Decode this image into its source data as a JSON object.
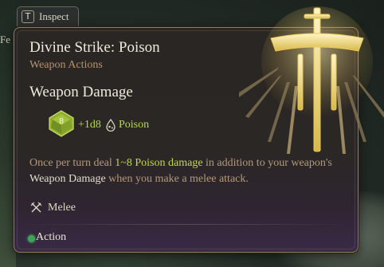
{
  "tab": {
    "key": "T",
    "label": "Inspect"
  },
  "background_text": "Fe",
  "tooltip": {
    "title": "Divine Strike: Poison",
    "subtitle": "Weapon Actions",
    "section_title": "Weapon Damage",
    "damage": {
      "dice": "+1d8",
      "type": "Poison",
      "die_icon": "d8-die-icon",
      "type_icon": "poison-icon"
    },
    "description": {
      "part1": "Once per turn deal ",
      "highlight": "1~8 Poison damage",
      "part2": " in addition to your weapon's ",
      "weapon_damage": "Weapon Damage",
      "part3": " when you make a melee attack."
    },
    "range_type": "Melee",
    "range_icon": "crossed-swords-icon",
    "cost": "Action",
    "cost_icon": "action-dot-icon"
  },
  "colors": {
    "poison_green": "#b8d84a",
    "subtitle": "#b7926e",
    "border_gold": "#8e7b58",
    "action_green": "#3da55a"
  }
}
